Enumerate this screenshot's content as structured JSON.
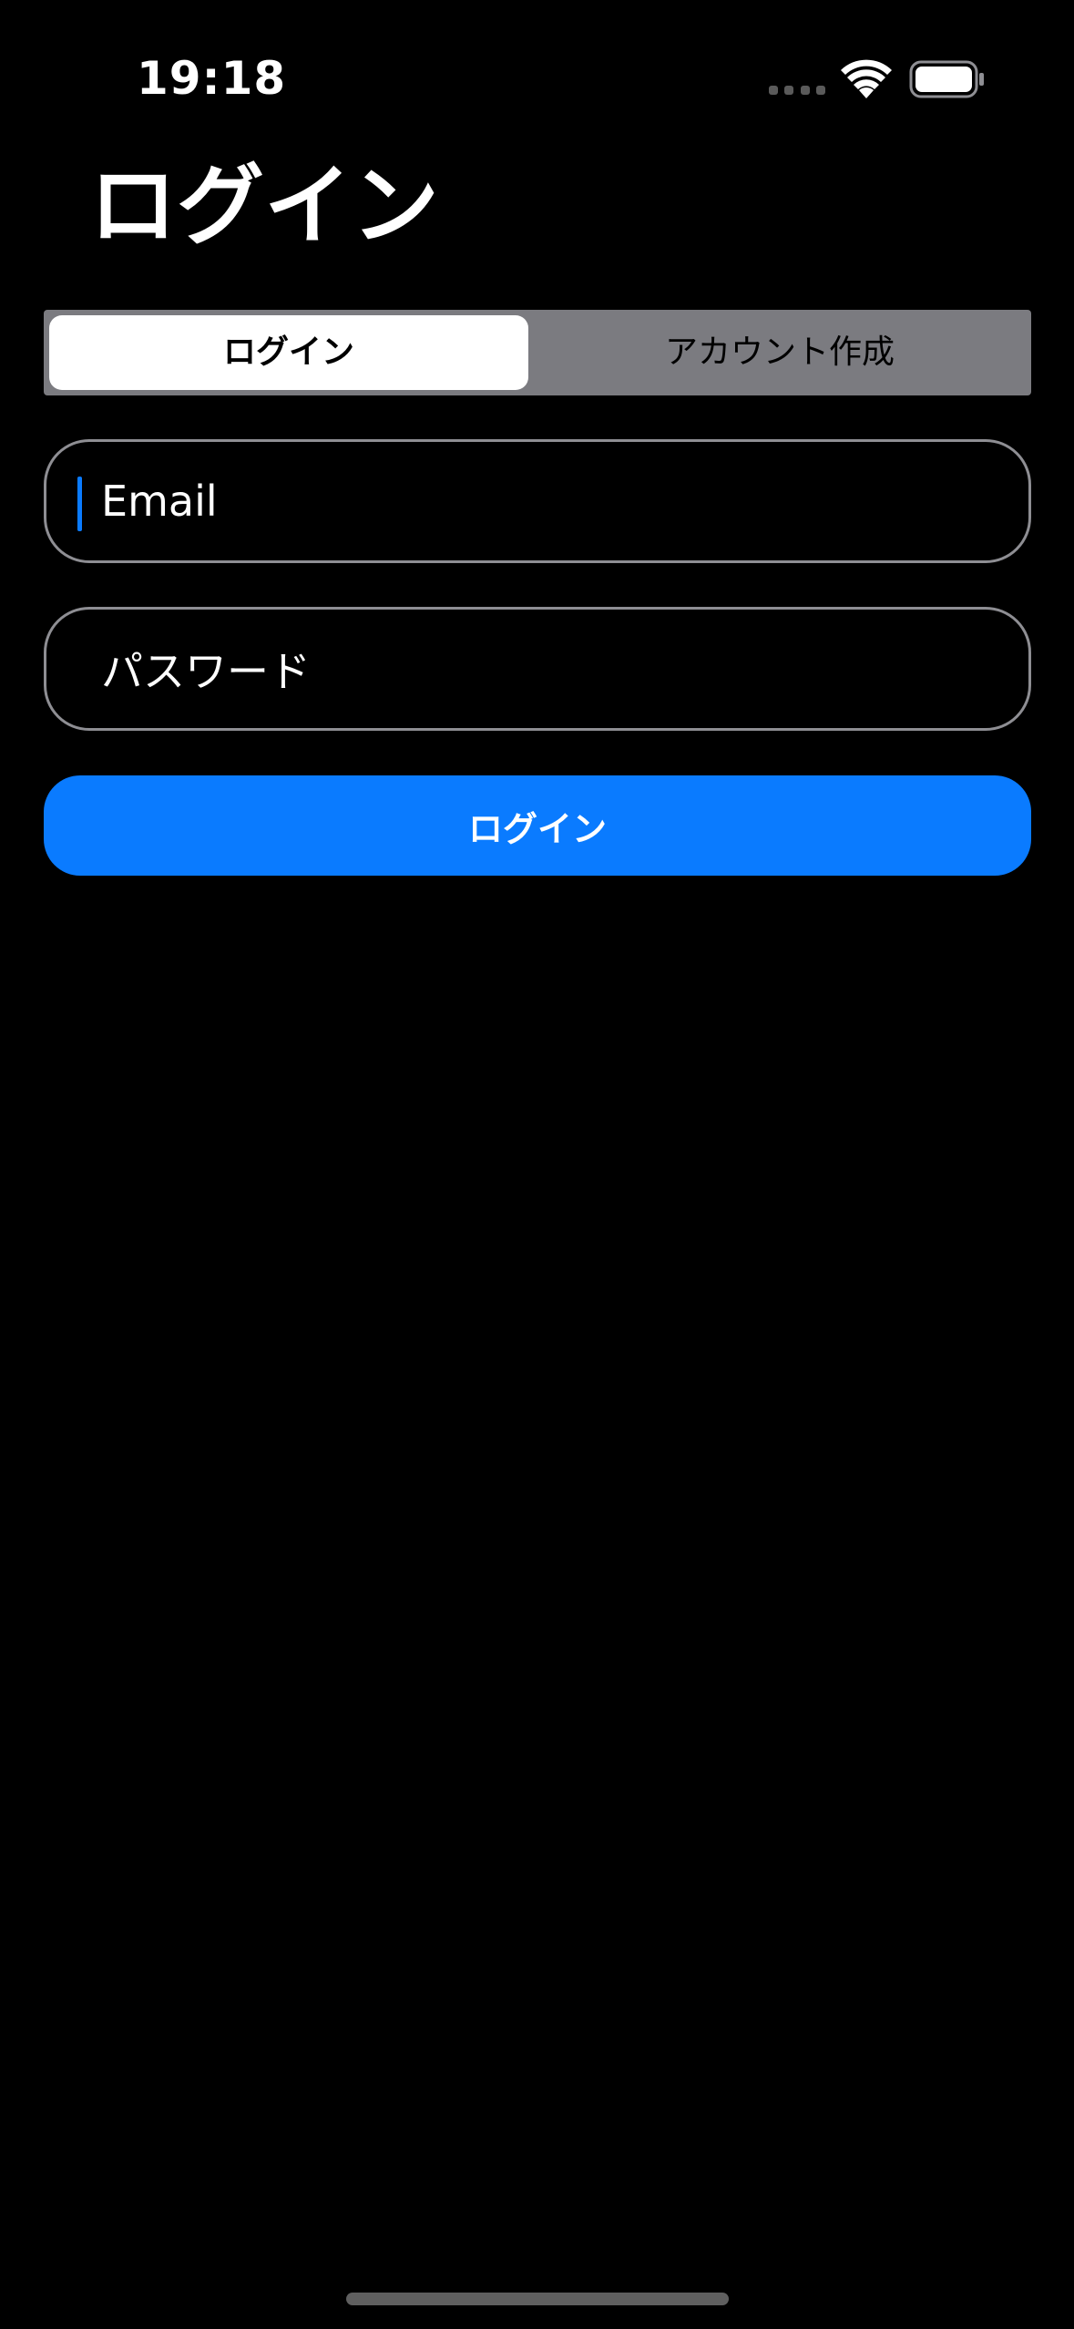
{
  "status_bar": {
    "time": "19:18"
  },
  "page": {
    "title": "ログイン"
  },
  "segmented_control": {
    "segments": [
      {
        "label": "ログイン",
        "selected": true
      },
      {
        "label": "アカウント作成",
        "selected": false
      }
    ]
  },
  "form": {
    "email": {
      "placeholder": "Email",
      "value": ""
    },
    "password": {
      "placeholder": "パスワード",
      "value": ""
    },
    "submit_label": "ログイン"
  },
  "icons": {
    "cellular": "cellular-signal-icon",
    "wifi": "wifi-icon",
    "battery": "battery-icon"
  },
  "colors": {
    "background": "#000000",
    "accent": "#0a7bff",
    "segment_track": "#7b7b80",
    "field_border": "#8e8e93"
  }
}
